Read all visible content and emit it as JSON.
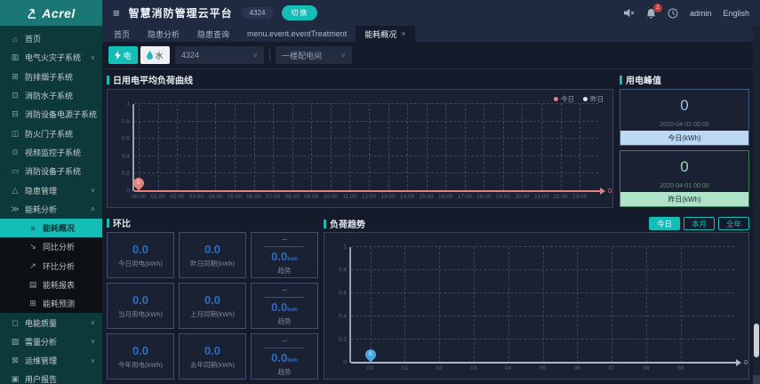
{
  "brand": {
    "logo_text": "Acrel"
  },
  "header": {
    "title": "智慧消防管理云平台",
    "badge": "4324",
    "switch_label": "切换",
    "notification_count": "2",
    "username": "admin",
    "language": "English"
  },
  "icons": {
    "hamburger": "≡",
    "close": "×",
    "select_chevron": "∨"
  },
  "sidebar": {
    "items": [
      {
        "label": "首页",
        "glyph": "⌂"
      },
      {
        "label": "电气火灾子系统",
        "glyph": "▥",
        "chevron": "∨"
      },
      {
        "label": "防排烟子系统",
        "glyph": "⊞"
      },
      {
        "label": "消防水子系统",
        "glyph": "⊡"
      },
      {
        "label": "消防设备电源子系统",
        "glyph": "⊟"
      },
      {
        "label": "防火门子系统",
        "glyph": "◫"
      },
      {
        "label": "视频监控子系统",
        "glyph": "⊙"
      },
      {
        "label": "消防设备子系统",
        "glyph": "▭"
      },
      {
        "label": "隐患管理",
        "glyph": "△",
        "chevron": "∨"
      },
      {
        "label": "能耗分析",
        "glyph": "≫",
        "chevron": "∧"
      }
    ],
    "submenu": [
      {
        "label": "能耗概况",
        "glyph": "≡",
        "active": true
      },
      {
        "label": "同比分析",
        "glyph": "↘"
      },
      {
        "label": "环比分析",
        "glyph": "↗"
      },
      {
        "label": "能耗报表",
        "glyph": "▤"
      },
      {
        "label": "能耗预测",
        "glyph": "⊞"
      }
    ],
    "items_lower": [
      {
        "label": "电能质量",
        "glyph": "◻",
        "chevron": "∨"
      },
      {
        "label": "需量分析",
        "glyph": "▨",
        "chevron": "∨"
      },
      {
        "label": "运维管理",
        "glyph": "⊠",
        "chevron": "∨"
      },
      {
        "label": "用户报告",
        "glyph": "▣"
      }
    ]
  },
  "tabs": [
    {
      "label": "首页"
    },
    {
      "label": "隐患分析"
    },
    {
      "label": "隐患查询"
    },
    {
      "label": "menu.event.eventTreatment"
    },
    {
      "label": "能耗概况",
      "active": true,
      "closable": true
    }
  ],
  "filters": {
    "electric_label": "电",
    "water_label": "水",
    "device_select": "4324",
    "room_select": "一楼配电间"
  },
  "peak": {
    "title": "用电峰值",
    "cards": [
      {
        "value": "0",
        "datetime": "2020-04-02 00:00",
        "label": "今日(kWh)",
        "border": "#3e5a7d",
        "accent": "#bcd8f2",
        "value_color": "#9cbfe3",
        "date_color": "#64748c"
      },
      {
        "value": "0",
        "datetime": "2020-04-01 00:00",
        "label": "昨日(kWh)",
        "border": "#3e7d5f",
        "accent": "#b0e4c8",
        "value_color": "#9dd8b6",
        "date_color": "#648c74"
      }
    ]
  },
  "ring": {
    "title": "环比",
    "cards": [
      {
        "type": "value",
        "value": "0.0",
        "label": "今日用电(kWh)"
      },
      {
        "type": "value",
        "value": "0.0",
        "label": "昨日同期(kWh)"
      },
      {
        "type": "trend",
        "top": "--",
        "value": "0.0",
        "unit": "kwh",
        "label": "趋势"
      },
      {
        "type": "value",
        "value": "0.0",
        "label": "当月用电(kWh)"
      },
      {
        "type": "value",
        "value": "0.0",
        "label": "上月同期(kWh)"
      },
      {
        "type": "trend",
        "top": "--",
        "value": "0.0",
        "unit": "kwh",
        "label": "趋势"
      },
      {
        "type": "value",
        "value": "0.0",
        "label": "今年用电(kWh)"
      },
      {
        "type": "value",
        "value": "0.0",
        "label": "去年同期(kWh)"
      },
      {
        "type": "trend",
        "top": "--",
        "value": "0.0",
        "unit": "kwh",
        "label": "趋势"
      }
    ]
  },
  "load_trend": {
    "title": "负荷趋势",
    "buttons": [
      {
        "label": "今日",
        "active": true
      },
      {
        "label": "本月"
      },
      {
        "label": "全年"
      }
    ]
  },
  "colors": {
    "accent_teal": "#14bdb6",
    "sidebar_green": "#0e393b",
    "logo_teal": "#1b7776",
    "header_navy": "#1f2940",
    "page_navy": "#151b2a",
    "value_blue": "#2e6cc2",
    "today_red": "#e87f7f",
    "marker_blue": "#4da3dc"
  },
  "chart_data": [
    {
      "id": "daily-load-curve",
      "type": "line",
      "title": "日用电平均负荷曲线",
      "legend": [
        {
          "name": "今日",
          "color": "#e87f7f"
        },
        {
          "name": "昨日",
          "color": "#e3e6ea"
        }
      ],
      "x": [
        "00:00",
        "01:00",
        "02:00",
        "03:00",
        "04:00",
        "05:00",
        "06:00",
        "07:00",
        "08:00",
        "09:00",
        "10:00",
        "11:00",
        "12:00",
        "13:00",
        "14:00",
        "15:00",
        "16:00",
        "17:00",
        "18:00",
        "19:00",
        "20:00",
        "21:00",
        "22:00",
        "23:00"
      ],
      "yticks": [
        "0",
        "0.2",
        "0.4",
        "0.6",
        "0.8",
        "1"
      ],
      "ylim": [
        0,
        1
      ],
      "series": [
        {
          "name": "今日",
          "color": "#e87f7f",
          "values": [
            0,
            0,
            0,
            0,
            0,
            0,
            0,
            0,
            0,
            0,
            0,
            0,
            0,
            0,
            0,
            0,
            0,
            0,
            0,
            0,
            0,
            0,
            0,
            0
          ]
        }
      ],
      "marker": {
        "x_index": 0,
        "label": "0",
        "color": "#e87f7f"
      },
      "axis_end_label": "0",
      "x_span_pct": [
        1,
        96
      ]
    },
    {
      "id": "load-trend",
      "type": "line",
      "title": "负荷趋势",
      "x": [
        "00",
        "01",
        "02",
        "03",
        "04",
        "05",
        "06",
        "07",
        "08",
        "09"
      ],
      "yticks": [
        "0",
        "0.2",
        "0.4",
        "0.6",
        "0.8",
        "1"
      ],
      "ylim": [
        0,
        1
      ],
      "series": [
        {
          "name": "负荷",
          "color": "#aeb6c4",
          "values": [
            0,
            0,
            0,
            0,
            0,
            0,
            0,
            0,
            0,
            0
          ]
        }
      ],
      "marker": {
        "x_index": 0,
        "label": "0",
        "color": "#4da3dc"
      },
      "axis_end_label": "0",
      "x_span_pct": [
        5,
        86
      ]
    }
  ]
}
